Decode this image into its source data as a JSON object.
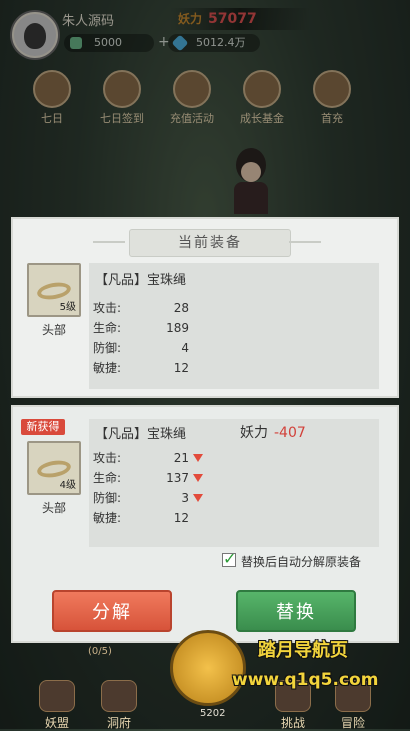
{
  "header": {
    "username": "朱人源码",
    "jade": "5000",
    "plus": "+",
    "crystal": "5012.4万",
    "power_label": "妖力",
    "power_value": "57077"
  },
  "menu": [
    "七日",
    "七日签到",
    "充值活动",
    "成长基金",
    "首充"
  ],
  "current_equip": {
    "title": "当前装备",
    "name": "【凡品】宝珠绳",
    "level": "5级",
    "slot": "头部",
    "stats": [
      {
        "label": "攻击:",
        "value": "28"
      },
      {
        "label": "生命:",
        "value": "189"
      },
      {
        "label": "防御:",
        "value": "4"
      },
      {
        "label": "敏捷:",
        "value": "12"
      }
    ]
  },
  "new_equip": {
    "tag": "新获得",
    "name": "【凡品】宝珠绳",
    "level": "4级",
    "slot": "头部",
    "power_label": "妖力",
    "power_diff": "-407",
    "stats": [
      {
        "label": "攻击:",
        "value": "21",
        "down": true
      },
      {
        "label": "生命:",
        "value": "137",
        "down": true
      },
      {
        "label": "防御:",
        "value": "3",
        "down": true
      },
      {
        "label": "敏捷:",
        "value": "12",
        "down": false
      }
    ],
    "auto_decompose_label": "替换后自动分解原装备",
    "auto_decompose_checked": true
  },
  "actions": {
    "decompose": "分解",
    "replace": "替换"
  },
  "bottom_nav": {
    "items": [
      "妖盟",
      "洞府",
      "挑战",
      "冒险"
    ],
    "progress": "(0/5)",
    "coins": "5202"
  },
  "watermark": {
    "line1": "踏月导航页",
    "line2": "www.q1q5.com"
  },
  "colors": {
    "decrease": "#e24b3b",
    "decompose_button": "#d7533a",
    "replace_button": "#3a8d4d",
    "new_tag": "#d94a3b"
  }
}
